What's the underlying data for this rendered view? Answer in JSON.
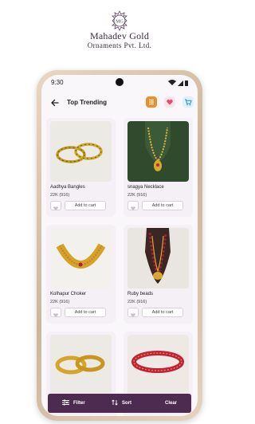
{
  "brand": {
    "logo_text": "MG",
    "name": "Mahadev Gold",
    "subtitle": "Ornaments Pvt. Ltd."
  },
  "status_bar": {
    "time": "9:30"
  },
  "app_bar": {
    "title": "Top Trending"
  },
  "products": [
    {
      "name": "Aadhya Bangles",
      "karat": "22K (916)",
      "cart_label": "Add to cart"
    },
    {
      "name": "snagya Necklace",
      "karat": "22K (916)",
      "cart_label": "Add to cart"
    },
    {
      "name": "Kolhapur Choker",
      "karat": "22K (916)",
      "cart_label": "Add to cart"
    },
    {
      "name": "Ruby beads",
      "karat": "22K (916)",
      "cart_label": "Add to cart"
    }
  ],
  "bottom_bar": {
    "filter_label": "Filter",
    "sort_label": "Sort",
    "clear_label": "Clear"
  },
  "colors": {
    "accent_bar": "#4d2a4f",
    "menu_icon_bg": "#f28c28",
    "card_bg": "#f5eff6"
  }
}
